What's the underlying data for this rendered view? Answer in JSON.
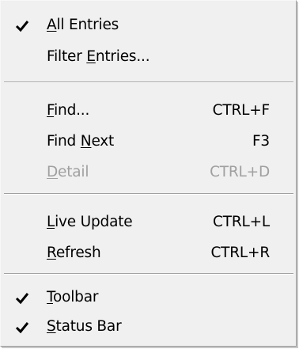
{
  "menu": {
    "items": [
      {
        "id": "all",
        "pre": "",
        "key": "A",
        "post": "ll Entries",
        "shortcut": "",
        "checked": true,
        "disabled": false
      },
      {
        "id": "filter",
        "pre": "Filter ",
        "key": "E",
        "post": "ntries...",
        "shortcut": "",
        "checked": false,
        "disabled": false
      },
      {
        "id": "find",
        "pre": "",
        "key": "F",
        "post": "ind...",
        "shortcut": "CTRL+F",
        "checked": false,
        "disabled": false
      },
      {
        "id": "findnext",
        "pre": "Find ",
        "key": "N",
        "post": "ext",
        "shortcut": "F3",
        "checked": false,
        "disabled": false
      },
      {
        "id": "detail",
        "pre": "",
        "key": "D",
        "post": "etail",
        "shortcut": "CTRL+D",
        "checked": false,
        "disabled": true
      },
      {
        "id": "live",
        "pre": "",
        "key": "L",
        "post": "ive Update",
        "shortcut": "CTRL+L",
        "checked": false,
        "disabled": false
      },
      {
        "id": "refresh",
        "pre": "",
        "key": "R",
        "post": "efresh",
        "shortcut": "CTRL+R",
        "checked": false,
        "disabled": false
      },
      {
        "id": "toolbar",
        "pre": "",
        "key": "T",
        "post": "oolbar",
        "shortcut": "",
        "checked": true,
        "disabled": false
      },
      {
        "id": "statusbar",
        "pre": "",
        "key": "S",
        "post": "tatus Bar",
        "shortcut": "",
        "checked": true,
        "disabled": false
      }
    ]
  },
  "colors": {
    "menu_background": "#f0f0f0",
    "text": "#000000",
    "disabled_text": "#a0a0a0",
    "separator": "#a0a0a0"
  },
  "icons": {
    "check": "check-icon"
  }
}
